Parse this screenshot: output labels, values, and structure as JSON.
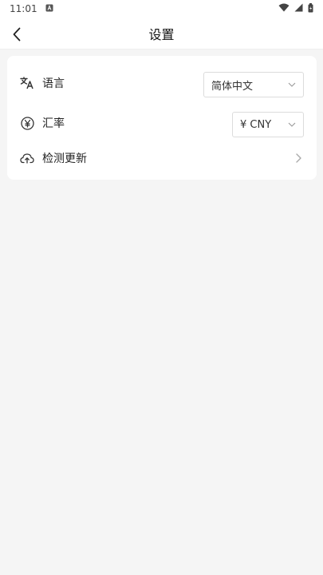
{
  "status_bar": {
    "time": "11:01",
    "icons": [
      "notification-a-icon",
      "wifi-icon",
      "signal-icon",
      "battery-icon"
    ]
  },
  "header": {
    "title": "设置",
    "back_icon": "chevron-left-icon"
  },
  "settings": {
    "language": {
      "label": "语言",
      "icon": "translate-icon",
      "selected": "简体中文"
    },
    "exchange_rate": {
      "label": "汇率",
      "icon": "yen-circle-icon",
      "selected": "¥ CNY"
    },
    "check_update": {
      "label": "检测更新",
      "icon": "cloud-upload-icon"
    }
  },
  "colors": {
    "background": "#f5f5f5",
    "card": "#ffffff",
    "text": "#222222",
    "border": "#dcdcdc"
  }
}
